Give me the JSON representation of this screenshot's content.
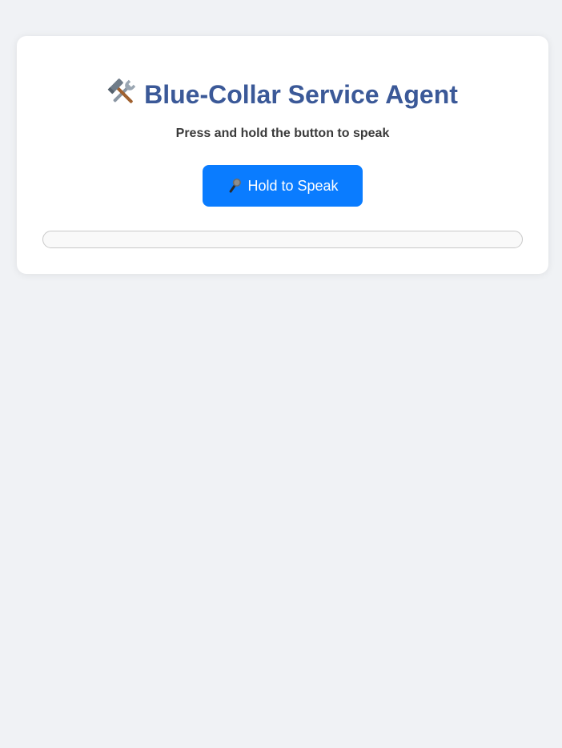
{
  "page": {
    "title": "Blue-Collar Service Agent",
    "title_icon": "hammer-and-wrench-icon",
    "subtitle": "Press and hold the button to speak"
  },
  "speak_button": {
    "label": "Hold to Speak",
    "icon": "microphone-icon"
  },
  "transcript": {
    "text": ""
  },
  "colors": {
    "background": "#f0f2f5",
    "card": "#ffffff",
    "title": "#3b5998",
    "button": "#0a7cff",
    "button_text": "#ffffff"
  }
}
